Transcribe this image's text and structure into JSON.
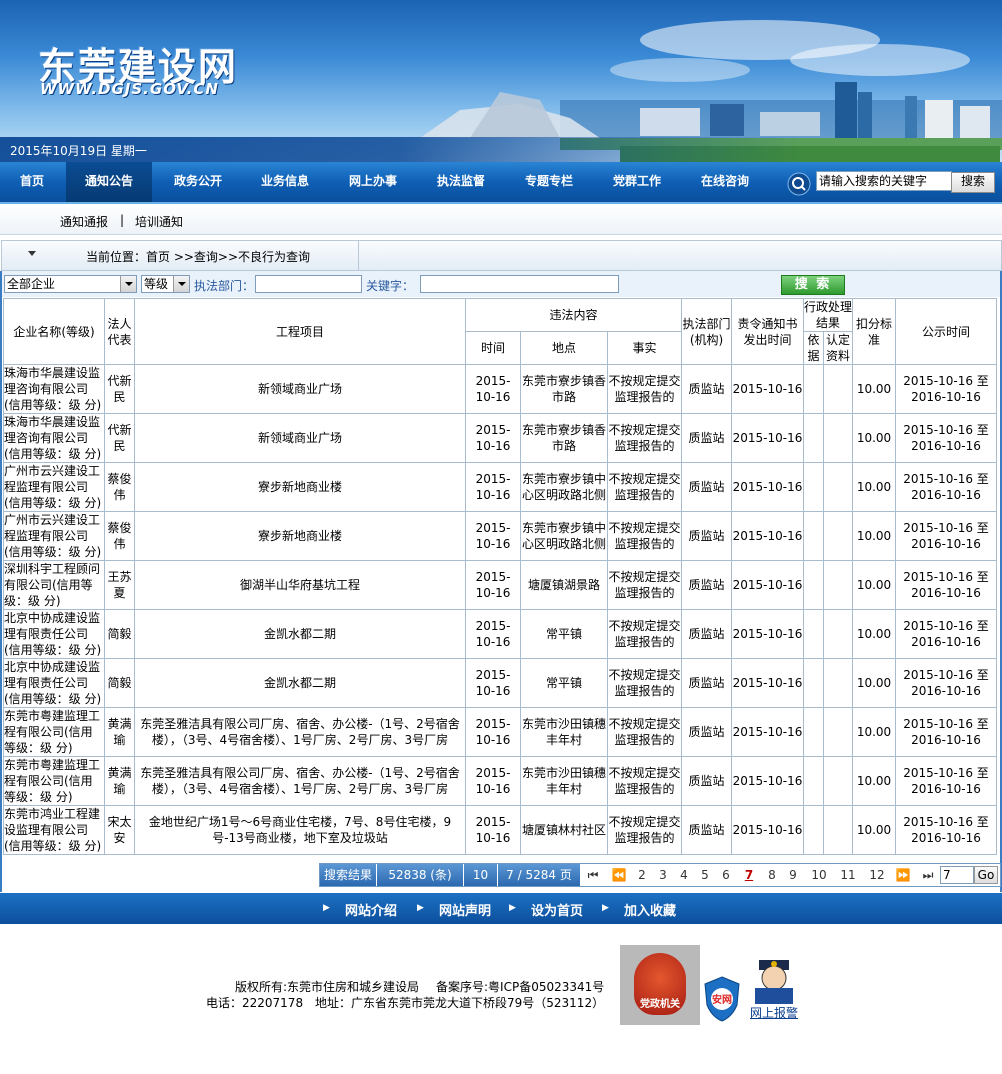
{
  "site": {
    "title": "东莞建设网",
    "url": "WWW.DGJS.GOV.CN",
    "date": "2015年10月19日  星期一"
  },
  "nav": {
    "items": [
      "首页",
      "通知公告",
      "政务公开",
      "业务信息",
      "网上办事",
      "执法监督",
      "专题专栏",
      "党群工作",
      "在线咨询"
    ],
    "active": "通知公告",
    "search_placeholder": "请输入搜索的关键字",
    "search_button": "搜索"
  },
  "subnav": {
    "items": [
      "通知通报",
      "培训通知"
    ],
    "separator": "|"
  },
  "breadcrumb": {
    "text": "当前位置：首页  >>查询>>不良行为查询"
  },
  "filters": {
    "enterprise_select": "全部企业",
    "grade_select": "等级",
    "dept_label": "执法部门：",
    "keyword_label": "关键字：",
    "search_button": "搜 索"
  },
  "table": {
    "headers": {
      "company": "企业名称(等级)",
      "legal": "法人代表",
      "project": "工程项目",
      "violation": "违法内容",
      "time": "时间",
      "place": "地点",
      "fact": "事实",
      "dept": "执法部门(机构)",
      "notice_time": "责令通知书发出时间",
      "admin": "行政处理结果",
      "basis": "依据",
      "material": "认定资料",
      "deduct": "扣分标准",
      "publish": "公示时间"
    },
    "rows": [
      {
        "company": "珠海市华晨建设监理咨询有限公司(信用等级：级 分)",
        "legal": "代新民",
        "project": "新领域商业广场",
        "time": "2015-10-16",
        "place": "东莞市寮步镇香市路",
        "fact": "不按规定提交监理报告的",
        "dept": "质监站",
        "notice": "2015-10-16",
        "basis": "",
        "material": "",
        "deduct": "10.00",
        "publish": "2015-10-16 至 2016-10-16"
      },
      {
        "company": "珠海市华晨建设监理咨询有限公司(信用等级：级 分)",
        "legal": "代新民",
        "project": "新领域商业广场",
        "time": "2015-10-16",
        "place": "东莞市寮步镇香市路",
        "fact": "不按规定提交监理报告的",
        "dept": "质监站",
        "notice": "2015-10-16",
        "basis": "",
        "material": "",
        "deduct": "10.00",
        "publish": "2015-10-16 至 2016-10-16"
      },
      {
        "company": "广州市云兴建设工程监理有限公司(信用等级：级 分)",
        "legal": "蔡俊伟",
        "project": "寮步新地商业楼",
        "time": "2015-10-16",
        "place": "东莞市寮步镇中心区明政路北侧",
        "fact": "不按规定提交监理报告的",
        "dept": "质监站",
        "notice": "2015-10-16",
        "basis": "",
        "material": "",
        "deduct": "10.00",
        "publish": "2015-10-16 至 2016-10-16"
      },
      {
        "company": "广州市云兴建设工程监理有限公司(信用等级：级 分)",
        "legal": "蔡俊伟",
        "project": "寮步新地商业楼",
        "time": "2015-10-16",
        "place": "东莞市寮步镇中心区明政路北侧",
        "fact": "不按规定提交监理报告的",
        "dept": "质监站",
        "notice": "2015-10-16",
        "basis": "",
        "material": "",
        "deduct": "10.00",
        "publish": "2015-10-16 至 2016-10-16"
      },
      {
        "company": "深圳科宇工程顾问有限公司(信用等级：级 分)",
        "legal": "王苏夏",
        "project": "御湖半山华府基坑工程",
        "time": "2015-10-16",
        "place": "塘厦镇湖景路",
        "fact": "不按规定提交监理报告的",
        "dept": "质监站",
        "notice": "2015-10-16",
        "basis": "",
        "material": "",
        "deduct": "10.00",
        "publish": "2015-10-16 至 2016-10-16"
      },
      {
        "company": "北京中协成建设监理有限责任公司(信用等级：级 分)",
        "legal": "简毅",
        "project": "金凯水都二期",
        "time": "2015-10-16",
        "place": "常平镇",
        "fact": "不按规定提交监理报告的",
        "dept": "质监站",
        "notice": "2015-10-16",
        "basis": "",
        "material": "",
        "deduct": "10.00",
        "publish": "2015-10-16 至 2016-10-16"
      },
      {
        "company": "北京中协成建设监理有限责任公司(信用等级：级 分)",
        "legal": "简毅",
        "project": "金凯水都二期",
        "time": "2015-10-16",
        "place": "常平镇",
        "fact": "不按规定提交监理报告的",
        "dept": "质监站",
        "notice": "2015-10-16",
        "basis": "",
        "material": "",
        "deduct": "10.00",
        "publish": "2015-10-16 至 2016-10-16"
      },
      {
        "company": "东莞市粤建监理工程有限公司(信用等级：级 分)",
        "legal": "黄满瑜",
        "project": "东莞圣雅洁具有限公司厂房、宿舍、办公楼-（1号、2号宿舍楼），（3号、4号宿舍楼）、1号厂房、2号厂房、3号厂房",
        "time": "2015-10-16",
        "place": "东莞市沙田镇穗丰年村",
        "fact": "不按规定提交监理报告的",
        "dept": "质监站",
        "notice": "2015-10-16",
        "basis": "",
        "material": "",
        "deduct": "10.00",
        "publish": "2015-10-16 至 2016-10-16"
      },
      {
        "company": "东莞市粤建监理工程有限公司(信用等级：级 分)",
        "legal": "黄满瑜",
        "project": "东莞圣雅洁具有限公司厂房、宿舍、办公楼-（1号、2号宿舍楼），（3号、4号宿舍楼）、1号厂房、2号厂房、3号厂房",
        "time": "2015-10-16",
        "place": "东莞市沙田镇穗丰年村",
        "fact": "不按规定提交监理报告的",
        "dept": "质监站",
        "notice": "2015-10-16",
        "basis": "",
        "material": "",
        "deduct": "10.00",
        "publish": "2015-10-16 至 2016-10-16"
      },
      {
        "company": "东莞市鸿业工程建设监理有限公司(信用等级：级 分)",
        "legal": "宋太安",
        "project": "金地世纪广场1号～6号商业住宅楼，7号、8号住宅楼，9号-13号商业楼，地下室及垃圾站",
        "time": "2015-10-16",
        "place": "塘厦镇林村社区",
        "fact": "不按规定提交监理报告的",
        "dept": "质监站",
        "notice": "2015-10-16",
        "basis": "",
        "material": "",
        "deduct": "10.00",
        "publish": "2015-10-16 至 2016-10-16"
      }
    ]
  },
  "pager": {
    "label": "搜索结果",
    "total": "52838 (条)",
    "page_size": "10",
    "page_info": "7 / 5284 页",
    "first": "⏮",
    "prev": "⏪",
    "pages": [
      "2",
      "3",
      "4",
      "5",
      "6",
      "7",
      "8",
      "9",
      "10",
      "11",
      "12"
    ],
    "current": "7",
    "next": "⏩",
    "last": "⏭",
    "goto_value": "7",
    "go": "Go"
  },
  "footer_nav": {
    "items": [
      "网站介绍",
      "网站声明",
      "设为首页",
      "加入收藏"
    ]
  },
  "copyright": {
    "owner": "版权所有:东莞市住房和城乡建设局",
    "icp": "备案序号:粤ICP备05023341号",
    "phone": "电话：22207178",
    "address": "地址：广东省东莞市莞龙大道下桥段79号（523112）",
    "badge_party": "党政机关",
    "badge_police": "网上报警"
  }
}
